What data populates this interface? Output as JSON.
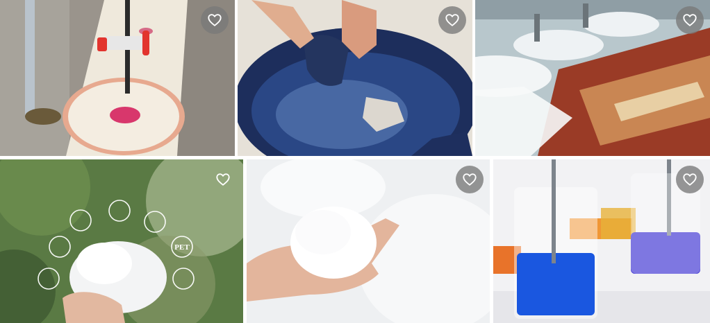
{
  "gallery": {
    "tiles": [
      {
        "name": "fabric-drop-test",
        "favorite_icon": "heart-outline-icon"
      },
      {
        "name": "denim-washing",
        "favorite_icon": "heart-outline-icon"
      },
      {
        "name": "carpet-cleaning-machine",
        "favorite_icon": "heart-outline-icon"
      },
      {
        "name": "recycled-fiber-icons",
        "favorite_icon": "heart-outline-icon",
        "badge_label": "PET"
      },
      {
        "name": "polyester-fiberfill-hand",
        "favorite_icon": "heart-outline-icon"
      },
      {
        "name": "dye-beakers",
        "favorite_icon": "heart-outline-icon"
      }
    ]
  },
  "colors": {
    "favorite_button_bg": "#787878",
    "heart_stroke": "#ffffff"
  }
}
